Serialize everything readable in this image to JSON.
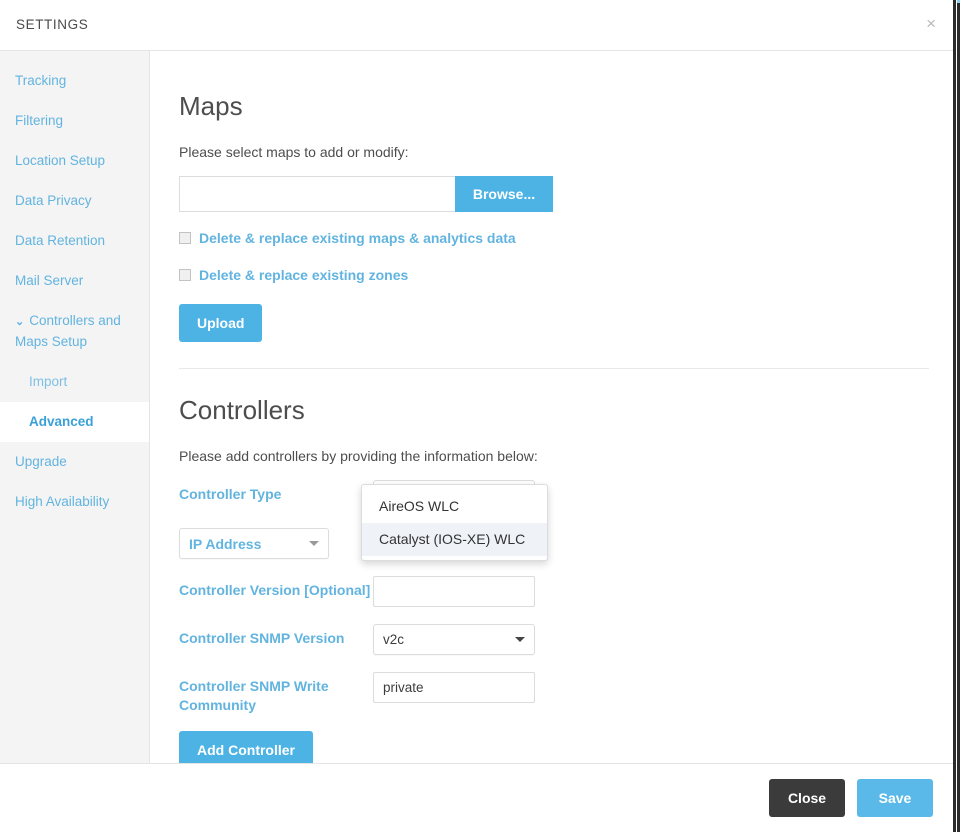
{
  "header": {
    "title": "SETTINGS",
    "close_icon": "close-icon",
    "close_glyph": "×"
  },
  "sidebar": {
    "items": [
      {
        "label": "Tracking",
        "level": "top",
        "active": false,
        "expandable": false
      },
      {
        "label": "Filtering",
        "level": "top",
        "active": false,
        "expandable": false
      },
      {
        "label": "Location Setup",
        "level": "top",
        "active": false,
        "expandable": false
      },
      {
        "label": "Data Privacy",
        "level": "top",
        "active": false,
        "expandable": false
      },
      {
        "label": "Data Retention",
        "level": "top",
        "active": false,
        "expandable": false
      },
      {
        "label": "Mail Server",
        "level": "top",
        "active": false,
        "expandable": false
      },
      {
        "label": "Controllers and Maps Setup",
        "level": "top",
        "active": false,
        "expandable": true,
        "caret": "⌄"
      },
      {
        "label": "Import",
        "level": "sub",
        "active": false,
        "expandable": false
      },
      {
        "label": "Advanced",
        "level": "sub",
        "active": true,
        "expandable": false
      },
      {
        "label": "Upgrade",
        "level": "top",
        "active": false,
        "expandable": false
      },
      {
        "label": "High Availability",
        "level": "top",
        "active": false,
        "expandable": false
      }
    ]
  },
  "maps": {
    "title": "Maps",
    "description": "Please select maps to add or modify:",
    "file_input_value": "",
    "file_input_placeholder": "",
    "browse_label": "Browse...",
    "checkbox_maps_label": "Delete & replace existing maps & analytics data",
    "checkbox_maps_checked": false,
    "checkbox_zones_label": "Delete & replace existing zones",
    "checkbox_zones_checked": false,
    "upload_label": "Upload"
  },
  "controllers": {
    "title": "Controllers",
    "description": "Please add controllers by providing the information below:",
    "controller_type": {
      "label": "Controller Type",
      "selected": "AireOS WLC",
      "open": true,
      "options": [
        {
          "label": "AireOS WLC",
          "highlighted": false
        },
        {
          "label": "Catalyst (IOS-XE) WLC",
          "highlighted": true
        }
      ]
    },
    "address_mode": {
      "label_selected": "IP Address"
    },
    "controller_version": {
      "label": "Controller Version [Optional]",
      "value": "",
      "placeholder": ""
    },
    "snmp_version": {
      "label": "Controller SNMP Version",
      "selected": "v2c"
    },
    "snmp_write_community": {
      "label": "Controller SNMP Write Community",
      "value": "private",
      "placeholder": ""
    },
    "add_button_label": "Add Controller"
  },
  "footer": {
    "close_label": "Close",
    "save_label": "Save"
  },
  "colors": {
    "accent_blue": "#4db3e5",
    "link_blue": "#62b4e0",
    "dark_button": "#3b3b3b",
    "sidebar_bg": "#f4f4f4",
    "text_dark": "#4d4d4d"
  }
}
